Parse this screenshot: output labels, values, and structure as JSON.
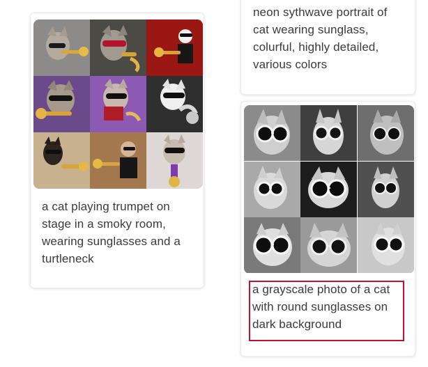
{
  "cards": [
    {
      "id": "left",
      "caption_lines": [
        "a cat playing trumpet on",
        "stage in a smoky room,",
        "wearing sunglasses and a",
        "turtleneck"
      ]
    },
    {
      "id": "right_top",
      "caption_lines": [
        "neon sythwave portrait of",
        "cat wearing sunglass,",
        "colurful, highly detailed,",
        "various colors"
      ]
    },
    {
      "id": "right_bottom",
      "caption_lines": [
        "a grayscale photo of a cat",
        "with round sunglasses on",
        "dark background"
      ]
    }
  ],
  "highlight": {
    "color": "#c8102e"
  },
  "icons": {
    "left_grid": "cat-trumpet-image-grid",
    "right_grid": "grayscale-cat-sunglasses-image-grid"
  }
}
